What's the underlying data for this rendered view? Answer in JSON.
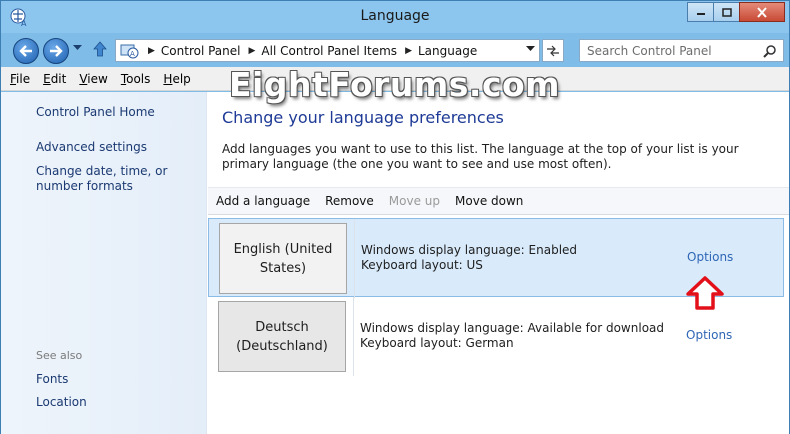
{
  "window": {
    "title": "Language",
    "accent": "#8cc6ee"
  },
  "nav": {
    "breadcrumbs": [
      "Control Panel",
      "All Control Panel Items",
      "Language"
    ],
    "search_placeholder": "Search Control Panel"
  },
  "menu": {
    "items": [
      "File",
      "Edit",
      "View",
      "Tools",
      "Help"
    ]
  },
  "watermark": "EightForums.com",
  "sidebar": {
    "home": "Control Panel Home",
    "links": [
      "Advanced settings",
      "Change date, time, or number formats"
    ],
    "see_also_label": "See also",
    "see_also": [
      "Fonts",
      "Location"
    ]
  },
  "main": {
    "title": "Change your language preferences",
    "description": "Add languages you want to use to this list. The language at the top of your list is your primary language (the one you want to see and use most often).",
    "toolbar": {
      "add": "Add a language",
      "remove": "Remove",
      "move_up": "Move up",
      "move_down": "Move down"
    },
    "languages": [
      {
        "name": "English (United States)",
        "display": "Windows display language: Enabled",
        "keyboard": "Keyboard layout: US",
        "options": "Options"
      },
      {
        "name": "Deutsch (Deutschland)",
        "display": "Windows display language: Available for download",
        "keyboard": "Keyboard layout: German",
        "options": "Options"
      }
    ]
  },
  "colors": {
    "link": "#2f66b5",
    "title": "#1e3a96",
    "selected_row": "#d9ebfb",
    "annotation_arrow": "#e3101a"
  }
}
